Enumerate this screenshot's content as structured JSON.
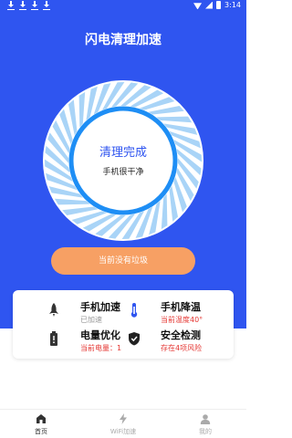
{
  "status_bar": {
    "time": "3:14"
  },
  "app": {
    "title": "闪电清理加速"
  },
  "dial": {
    "title": "清理完成",
    "subtitle": "手机很干净"
  },
  "clean_button": {
    "label": "当前没有垃圾"
  },
  "features": [
    {
      "name": "手机加速",
      "sub": "已加速",
      "sub_color": "#999999",
      "icon": "rocket-icon"
    },
    {
      "name": "手机降温",
      "sub": "当前温度40°",
      "sub_color": "#e53935",
      "icon": "thermometer-icon"
    },
    {
      "name": "电量优化",
      "sub": "当前电量：1",
      "sub_color": "#e53935",
      "icon": "battery-icon"
    },
    {
      "name": "安全检测",
      "sub": "存在4项风险",
      "sub_color": "#e53935",
      "icon": "shield-icon"
    }
  ],
  "tabs": [
    {
      "label": "首页",
      "icon": "home-icon",
      "active": true
    },
    {
      "label": "WiFi加速",
      "icon": "lightning-icon",
      "active": false
    },
    {
      "label": "我的",
      "icon": "user-icon",
      "active": false
    }
  ],
  "colors": {
    "primary": "#2f55f0",
    "accent": "#f7a064",
    "warning": "#e53935",
    "inactive": "#aaaaaa"
  }
}
